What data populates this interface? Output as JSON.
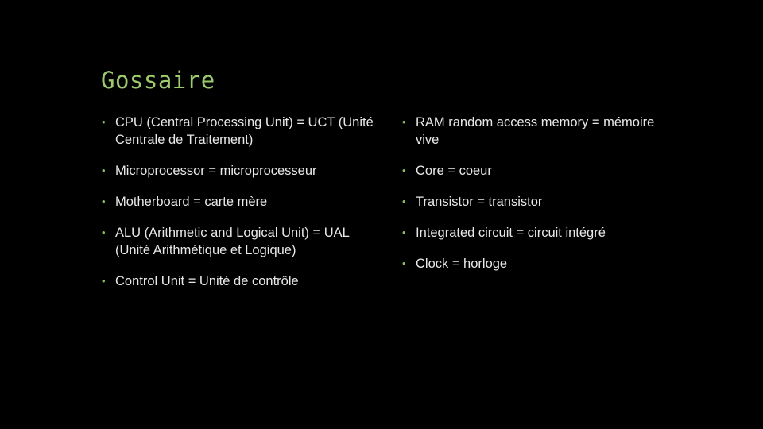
{
  "slide": {
    "title": "Gossaire",
    "left_items": [
      "CPU (Central Processing Unit) = UCT (Unité Centrale de Traitement)",
      "Microprocessor = microprocesseur",
      "Motherboard = carte mère",
      "ALU (Arithmetic and Logical Unit) = UAL (Unité Arithmétique et Logique)",
      "Control Unit = Unité de contrôle"
    ],
    "right_items": [
      "RAM random access memory = mémoire vive",
      "Core = coeur",
      "Transistor = transistor",
      "Integrated circuit = circuit intégré",
      "Clock = horloge"
    ],
    "bullet": "•",
    "colors": {
      "title": "#9ccb6c",
      "bullet": "#8cbf5a",
      "text": "#e8e8e8",
      "background": "#000000"
    }
  }
}
